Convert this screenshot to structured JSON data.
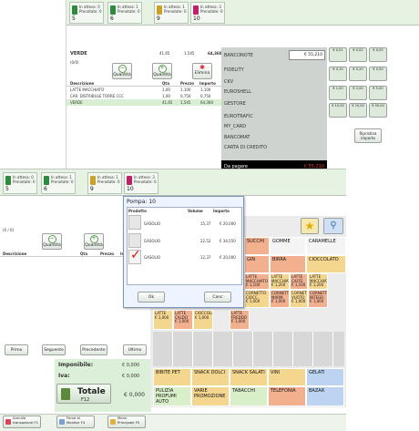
{
  "top_window": {
    "pumps": [
      {
        "num": "5",
        "status": "In attesa: 0",
        "preset": "Prenotate: 0",
        "color": "#2e8b3e"
      },
      {
        "num": "6",
        "status": "In attesa: 1",
        "preset": "Prenotate: 0",
        "color": "#2e8b3e"
      },
      {
        "num": "9",
        "status": "In attesa: 1",
        "preset": "Prenotate: 0",
        "color": "#c9a227"
      },
      {
        "num": "10",
        "status": "In attesa: 3",
        "preset": "Prenotate: 0",
        "color": "#c21f6b"
      }
    ],
    "receipt": {
      "title": "VERDE",
      "qty": "41,65",
      "price": "1,545",
      "amount": "64,360",
      "sub": "(0/0)",
      "qty_btn": "Quantità",
      "qty_btn2": "Quantità",
      "delete_btn": "Elimina",
      "headers": [
        "Descrizione",
        "Qta",
        "Prezzo",
        "Importo"
      ],
      "lines": [
        [
          "LATTE MACCHIATO",
          "1,00",
          "1,100",
          "1,100"
        ],
        [
          "CAR. DISTRIBULE TORRE CCC",
          "1,00",
          "0,750",
          "0,750"
        ],
        [
          "VERDE",
          "41,65",
          "1,545",
          "64,360"
        ]
      ]
    },
    "payments": [
      "BANCONOTE",
      "FIDELITY",
      "CKV",
      "EUROSHELL",
      "GESTORE",
      "EUROTRAFIC",
      "MY_CARD",
      "BANCOMAT",
      "CARTA DI CREDITO"
    ],
    "banconote_value": "€ 55,210",
    "da_pagare_label": "Da pagare",
    "da_pagare_value": "€ 55,210",
    "notes": [
      "€ 0,01",
      "€ 0,02",
      "€ 0,05",
      "€ 0,10",
      "€ 0,20",
      "€ 0,50",
      "€ 1,00",
      "€ 2,00",
      "€ 5,00",
      "€ 10,00",
      "€ 20,00",
      "€ 50,00"
    ],
    "ripristina": "Ripristina importo"
  },
  "bottom_window": {
    "pumps": [
      {
        "num": "5",
        "status": "In attesa: 0",
        "preset": "Prenotate: 0",
        "color": "#2e8b3e"
      },
      {
        "num": "6",
        "status": "In attesa: 1",
        "preset": "Prenotate: 0",
        "color": "#2e8b3e"
      },
      {
        "num": "9",
        "status": "In attesa: 1",
        "preset": "Prenotate: 0",
        "color": "#c9a227"
      },
      {
        "num": "10",
        "status": "In attesa: 3",
        "preset": "Prenotate: 0",
        "color": "#c21f6b"
      }
    ],
    "sub": "(0 / 0)",
    "qty_btn": "Quantità",
    "qty_btn2": "Quantità",
    "headers": [
      "Descrizione",
      "Qta",
      "Prezzo",
      "Importo"
    ],
    "nav": [
      "Primo",
      "Seguente",
      "Precedente",
      "Ultimo"
    ],
    "imponibile_label": "Imponibile:",
    "imponibile_value": "€ 0,000",
    "iva_label": "Iva:",
    "iva_value": "€ 0,000",
    "totale_label": "Totale",
    "totale_key": "F12",
    "totale_value": "€ 0,000",
    "footer_buttons": [
      {
        "label": "Annulla transazione",
        "key": "F1"
      },
      {
        "label": "Forza al Monitor",
        "key": "F4"
      },
      {
        "label": "Menu Principale",
        "key": "F5"
      }
    ],
    "categories": [
      {
        "label": "SUCCHI",
        "color": "#f3b08f"
      },
      {
        "label": "GOMME",
        "color": "#f4f4f4"
      },
      {
        "label": "CARAMELLE",
        "color": "#f4f4f4"
      },
      {
        "label": "GIN",
        "color": "#f3b08f"
      },
      {
        "label": "BIRRA",
        "color": "#f3b08f"
      },
      {
        "label": "CIOCCOLATO",
        "color": "#f5d68f"
      },
      {
        "label": "BIBITE PET",
        "color": "#f5d68f"
      },
      {
        "label": "SNACK DOLCI",
        "color": "#f5d68f"
      },
      {
        "label": "SNACK SALATI",
        "color": "#f5d68f"
      },
      {
        "label": "VINI",
        "color": "#f5d68f"
      },
      {
        "label": "GELATI",
        "color": "#bcd4f2"
      },
      {
        "label": "PULIZIA PROFUMI AUTO",
        "color": "#d9efc9"
      },
      {
        "label": "VARIE PROMOZIONE",
        "color": "#f5d68f"
      },
      {
        "label": "TABACCHI",
        "color": "#d9efc9"
      },
      {
        "label": "TELEFONIA",
        "color": "#f3b08f"
      },
      {
        "label": "BAZAR",
        "color": "#bcd4f2"
      }
    ],
    "products": [
      {
        "name": "LATTE MACCHIATO",
        "price": "€ 1,100",
        "color": "#f3b08f"
      },
      {
        "name": "LATTE MACCHIATO",
        "price": "€ 1,200",
        "color": "#f5d68f"
      },
      {
        "name": "LATTE CAFFE",
        "price": "€ 1,100",
        "color": "#f3b08f"
      },
      {
        "name": "LATTE MACCHIATO",
        "price": "€ 1,200",
        "color": "#f5d68f"
      },
      {
        "name": "CORNETTO CIOCC.",
        "price": "€ 1,000",
        "color": "#f5d68f"
      },
      {
        "name": "CORNETTO MARM.",
        "price": "€ 1,000",
        "color": "#f3b08f"
      },
      {
        "name": "CORNETTO VUOTO",
        "price": "€ 1,000",
        "color": "#f5d68f"
      },
      {
        "name": "CORNETTO INTEGR.",
        "price": "€ 1,000",
        "color": "#f3b08f"
      },
      {
        "name": "LATTE",
        "price": "€ 1,000",
        "color": "#f5d68f"
      },
      {
        "name": "LATTE CALDO",
        "price": "€ 1,000",
        "color": "#f3b08f"
      },
      {
        "name": "CIOCCOLATA",
        "price": "€ 1,000",
        "color": "#f5d68f"
      },
      {
        "name": "LATTE FREDDO",
        "price": "€ 1,000",
        "color": "#f3b08f"
      }
    ]
  },
  "pump_dialog": {
    "title": "Pompa: 10",
    "headers": [
      "Prodotto",
      "Volume",
      "Importo"
    ],
    "rows": [
      {
        "product": "GASOLIO",
        "volume": "15,37",
        "amount": "€ 20,000",
        "checked": false
      },
      {
        "product": "GASOLIO",
        "volume": "22,52",
        "amount": "€ 34,550",
        "checked": false
      },
      {
        "product": "GASOLIO",
        "volume": "12,37",
        "amount": "€ 20,000",
        "checked": true
      }
    ],
    "ok": "Ok",
    "cancel": "Canc"
  }
}
